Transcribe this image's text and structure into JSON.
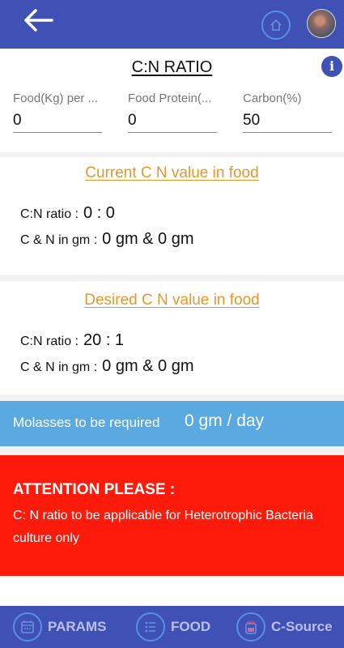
{
  "header": {
    "back_icon": "arrow-left-icon",
    "home_icon": "home-icon"
  },
  "form": {
    "title": "C:N RATIO",
    "info_icon_glyph": "i",
    "fields": [
      {
        "label": "Food(Kg) per ...",
        "value": "0"
      },
      {
        "label": "Food Protein(...",
        "value": "0"
      },
      {
        "label": "Carbon(%)",
        "value": "50"
      }
    ]
  },
  "current": {
    "heading": "Current C N value in food",
    "ratio_label": "C:N ratio :",
    "ratio_value": "0 : 0",
    "gm_label": "C & N in gm :",
    "gm_value": "0 gm & 0 gm"
  },
  "desired": {
    "heading": "Desired C N value in food",
    "ratio_label": "C:N ratio :",
    "ratio_value": "20 : 1",
    "gm_label": "C & N in gm :",
    "gm_value": "0 gm & 0 gm"
  },
  "molasses": {
    "label": "Molasses to be required",
    "value": "0 gm / day"
  },
  "attention": {
    "title": "ATTENTION PLEASE :",
    "body": "C: N ratio to be applicable for Heterotrophic Bacteria culture only"
  },
  "nav": {
    "items": [
      {
        "label": "PARAMS",
        "icon": "calendar-icon"
      },
      {
        "label": "FOOD",
        "icon": "list-icon"
      },
      {
        "label": "C-Source",
        "icon": "jar-icon"
      }
    ]
  },
  "colors": {
    "primary": "#3f51b5",
    "heading_orange": "#e6962b",
    "info_blue": "#5aa9e0",
    "alert_red": "#ff1a0a"
  }
}
